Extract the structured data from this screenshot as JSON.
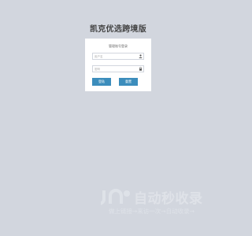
{
  "page": {
    "title": "凯克优选跨境版"
  },
  "login": {
    "message": "管理账号登录",
    "username_placeholder": "用户名",
    "password_placeholder": "密码",
    "login_label": "登陆",
    "clear_label": "重置"
  },
  "icons": {
    "username": "user-icon",
    "password": "lock-icon"
  },
  "watermark": {
    "title": "自动秒收录",
    "subtitle": "做上链接→来访一次→自动收录→"
  },
  "colors": {
    "background": "#d2d6de",
    "button": "#3c8dbc",
    "panel": "#ffffff"
  }
}
